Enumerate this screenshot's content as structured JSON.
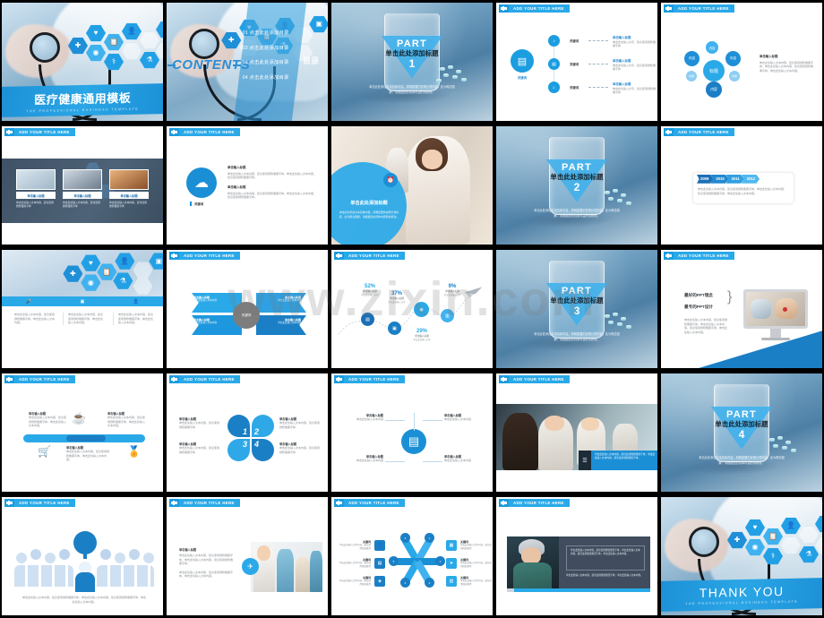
{
  "meta": {
    "watermark": "www.zixin.com",
    "grid": {
      "rows": 5,
      "cols": 5
    }
  },
  "common": {
    "title_bar": "ADD YOUR TITLE HERE",
    "plus_icon": "plus-icon"
  },
  "slides": [
    {
      "id": "cover",
      "kind": "cover",
      "title": "医疗健康通用模板",
      "subtitle": "THE PROFESSIONAL BUSINESS TEMPLATE"
    },
    {
      "id": "contents",
      "kind": "contents",
      "word": "CONTENTS",
      "side_word": "目录",
      "items": [
        "01 点击此处添加目录",
        "02 点击此处添加目录",
        "03 点击此处添加目录",
        "04 点击此处添加目录"
      ]
    },
    {
      "id": "part1",
      "kind": "part",
      "part_label": "PART",
      "part_number": "1",
      "part_title": "单击此处添加标题",
      "part_desc": "单击此处添加文本具体内容，简明扼要的说明分项内容，此为概念图解，请根据您的具体内容酌情修改。"
    },
    {
      "id": "process-3step",
      "kind": "process-vertical",
      "main_label": "关键词",
      "steps": [
        {
          "label": "关键词",
          "head": "单击输入标题",
          "body": "单击此处输入文字，建议使用微软雅黑字体"
        },
        {
          "label": "关键词",
          "head": "单击输入标题",
          "body": "单击此处输入文字，建议使用微软雅黑字体"
        },
        {
          "label": "关键词",
          "head": "单击输入标题",
          "body": "单击此处输入文字，建议使用微软雅黑字体"
        }
      ]
    },
    {
      "id": "hub-spoke",
      "kind": "hub",
      "center": "标题",
      "nodes": [
        "内容",
        "内容",
        "内容",
        "内容",
        "内容",
        "内容"
      ],
      "head": "单击输入标题",
      "body": "单击此处输入文本内容，建议使用微软雅黑字体，单击此处输入文本内容，建议使用微软雅黑字体，单击此处输入文本内容。"
    },
    {
      "id": "three-photos",
      "kind": "three-photo",
      "cards": [
        {
          "caption": "单击输入标题",
          "body": "单击此处输入文本内容，建议使用微软雅黑字体"
        },
        {
          "caption": "单击输入标题",
          "body": "单击此处输入文本内容，建议使用微软雅黑字体"
        },
        {
          "caption": "单击输入标题",
          "body": "单击此处输入文本内容，建议使用微软雅黑字体"
        }
      ]
    },
    {
      "id": "cloud-two-text",
      "kind": "icon-left-text",
      "icon": "cloud-icon",
      "icon_label": "关键词",
      "blocks": [
        {
          "head": "单击输入标题",
          "body": "单击此处输入文本内容，建议使用微软雅黑字体，单击此处输入文本内容，建议使用微软雅黑字体。"
        },
        {
          "head": "单击输入标题",
          "body": "单击此处输入文本内容，建议使用微软雅黑字体，单击此处输入文本内容，建议使用微软雅黑字体。"
        }
      ]
    },
    {
      "id": "doctor-circle",
      "kind": "photo-circle",
      "title": "单击此处添加标题",
      "body": "单击此处添加文本具体内容，简明扼要的说明分项内容，此为概念图解，请根据您的具体内容酌情修改。",
      "icon": "alarm-clock-icon"
    },
    {
      "id": "part2",
      "kind": "part",
      "part_label": "PART",
      "part_number": "2",
      "part_title": "单击此处添加标题",
      "part_desc": "单击此处添加文本具体内容，简明扼要的说明分项内容，此为概念图解，请根据您的具体内容酌情修改。"
    },
    {
      "id": "timeline",
      "kind": "timeline",
      "years": [
        "2009",
        "2010",
        "2011",
        "2012"
      ],
      "body": "单击此处输入文本内容，建议使用微软雅黑字体，单击此处输入文本内容，建议使用微软雅黑字体，单击此处输入文本内容。"
    },
    {
      "id": "hex-three-col",
      "kind": "hex-columns",
      "icons": [
        "microphone-icon",
        "camera-icon",
        "user-icon"
      ],
      "columns": [
        "单击此处输入文本内容，建议使用微软雅黑字体，单击此处输入文本内容。",
        "单击此处输入文本内容，建议使用微软雅黑字体，单击此处输入文本内容。",
        "单击此处输入文本内容，建议使用微软雅黑字体，单击此处输入文本内容。"
      ]
    },
    {
      "id": "four-quadrant",
      "kind": "quadrant",
      "center": "关键词",
      "quads": [
        {
          "head": "单击输入标题",
          "body": "单击此处输入文本内容"
        },
        {
          "head": "单击输入标题",
          "body": "单击此处输入文本内容"
        },
        {
          "head": "单击输入标题",
          "body": "单击此处输入文本内容"
        },
        {
          "head": "单击输入标题",
          "body": "单击此处输入文本内容"
        }
      ]
    },
    {
      "id": "percent-curve",
      "kind": "percent-curve",
      "points": [
        {
          "percent": "52%",
          "head": "单击输入标题",
          "body": "单击此处输入文本"
        },
        {
          "percent": "37%",
          "head": "单击输入标题",
          "body": "单击此处输入文本"
        },
        {
          "percent": "29%",
          "head": "单击输入标题",
          "body": "单击此处输入文本"
        },
        {
          "percent": "9%",
          "head": "单击输入标题",
          "body": "单击此处输入文本"
        }
      ]
    },
    {
      "id": "part3",
      "kind": "part",
      "part_label": "PART",
      "part_number": "3",
      "part_title": "单击此处添加标题",
      "part_desc": "单击此处添加文本具体内容，简明扼要的说明分项内容，此为概念图解，请根据您的具体内容酌情修改。"
    },
    {
      "id": "imac-mockup",
      "kind": "device",
      "line1": "最好的PPT理念",
      "line2": "最专的PPT设计",
      "body": "单击此处输入文本内容，建议使用微软雅黑字体，单击此处输入文本内容，建议使用微软雅黑字体，单击此处输入文本内容。"
    },
    {
      "id": "progress-four",
      "kind": "progress-bar",
      "items": [
        {
          "icon": "coffee-cup-icon",
          "head": "单击输入标题",
          "body": "单击此处输入文本内容，建议使用微软雅黑字体，单击此处输入文本内容。"
        },
        {
          "icon": "shopping-cart-icon",
          "head": "单击输入标题",
          "body": "单击此处输入文本内容，建议使用微软雅黑字体，单击此处输入文本内容。"
        },
        {
          "icon": "award-ribbon-icon",
          "head": "单击输入标题",
          "body": "单击此处输入文本内容，建议使用微软雅黑字体，单击此处输入文本内容。"
        }
      ]
    },
    {
      "id": "petal-four",
      "kind": "petals",
      "numbers": [
        "1",
        "2",
        "3",
        "4"
      ],
      "labels": [
        {
          "head": "单击输入标题",
          "body": "单击此处输入文本内容，建议使用微软雅黑字体"
        },
        {
          "head": "单击输入标题",
          "body": "单击此处输入文本内容，建议使用微软雅黑字体"
        },
        {
          "head": "单击输入标题",
          "body": "单击此处输入文本内容，建议使用微软雅黑字体"
        },
        {
          "head": "单击输入标题",
          "body": "单击此处输入文本内容，建议使用微软雅黑字体"
        }
      ]
    },
    {
      "id": "hub-books",
      "kind": "hub-two-side",
      "icon": "books-stack-icon",
      "left": [
        {
          "head": "单击输入标题",
          "body": "单击此处输入文本内容"
        },
        {
          "head": "单击输入标题",
          "body": "单击此处输入文本内容"
        }
      ],
      "right": [
        {
          "head": "单击输入标题",
          "body": "单击此处输入文本内容"
        },
        {
          "head": "单击输入标题",
          "body": "单击此处输入文本内容"
        }
      ]
    },
    {
      "id": "team-photo",
      "kind": "photo-caption",
      "icon": "list-icon",
      "body": "单击此处输入文本内容，建议使用微软雅黑字体，单击此处输入文本内容，建议使用微软雅黑字体。"
    },
    {
      "id": "part4",
      "kind": "part",
      "part_label": "PART",
      "part_number": "4",
      "part_title": "单击此处添加标题",
      "part_desc": "单击此处添加文本具体内容，简明扼要的说明分项内容，此为概念图解，请根据您的具体内容酌情修改。"
    },
    {
      "id": "crowd-leader",
      "kind": "crowd",
      "body": "单击此处输入文本内容，建议使用微软雅黑字体，单击此处输入文本内容，建议使用微软雅黑字体，单击此处输入文本内容。"
    },
    {
      "id": "doctor-team-text",
      "kind": "text-photo",
      "head": "单击输入标题",
      "body1": "单击此处输入文本内容，建议使用微软雅黑字体，单击此处输入文本内容，建议使用微软雅黑字体。",
      "body2": "单击此处输入文本内容，建议使用微软雅黑字体，单击此处输入文本内容。",
      "icon": "airplane-icon"
    },
    {
      "id": "six-petal-star",
      "kind": "star-six",
      "left": [
        {
          "head": "关键词",
          "body": "单击此处输入文本内容，建议使用微软雅黑"
        },
        {
          "head": "关键词",
          "body": "单击此处输入文本内容，建议使用微软雅黑"
        },
        {
          "head": "关键词",
          "body": "单击此处输入文本内容，建议使用微软雅黑"
        }
      ],
      "right": [
        {
          "head": "关键词",
          "body": "单击此处输入文本内容，建议使用微软雅黑"
        },
        {
          "head": "关键词",
          "body": "单击此处输入文本内容，建议使用微软雅黑"
        },
        {
          "head": "关键词",
          "body": "单击此处输入文本内容，建议使用微软雅黑"
        }
      ],
      "icons": [
        "user-icon",
        "bag-icon",
        "shield-icon",
        "calendar-icon",
        "send-icon",
        "chart-icon"
      ]
    },
    {
      "id": "surgeon-dark",
      "kind": "dark-photo-text",
      "body1": "单击此处输入文本内容，建议使用微软雅黑字体，单击此处输入文本内容，建议使用微软雅黑字体，单击此处输入文本内容。",
      "body2": "单击此处输入文本内容，建议使用微软雅黑字体，单击此处输入文本内容。"
    },
    {
      "id": "thank-you",
      "kind": "cover",
      "title": "THANK YOU",
      "subtitle": "THE PROFESSIONAL BUSINESS TEMPLATE"
    }
  ]
}
